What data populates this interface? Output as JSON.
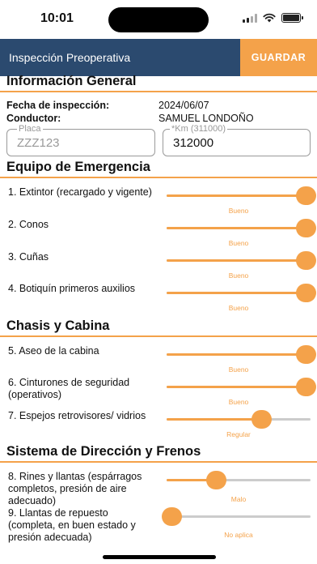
{
  "status": {
    "time": "10:01"
  },
  "header": {
    "title": "Inspección Preoperativa",
    "save_label": "GUARDAR"
  },
  "general": {
    "title": "Información General",
    "date_label": "Fecha de inspección:",
    "date_value": "2024/06/07",
    "driver_label": "Conductor:",
    "driver_value": "SAMUEL LONDOÑO",
    "plate_label": "Placa",
    "plate_value": "ZZZ123",
    "km_label": "*Km (311000)",
    "km_value": "312000"
  },
  "sections": {
    "emergency": {
      "title": "Equipo de Emergencia",
      "items": [
        {
          "label": "1. Extintor (recargado y vigente)",
          "value": "Bueno",
          "level": 1.0
        },
        {
          "label": "2. Conos",
          "value": "Bueno",
          "level": 1.0
        },
        {
          "label": "3. Cuñas",
          "value": "Bueno",
          "level": 1.0
        },
        {
          "label": "4. Botiquín primeros auxilios",
          "value": "Bueno",
          "level": 1.0
        }
      ]
    },
    "chassis": {
      "title": "Chasis y Cabina",
      "items": [
        {
          "label": "5. Aseo de la cabina",
          "value": "Bueno",
          "level": 1.0
        },
        {
          "label": "6. Cinturones de seguridad (operativos)",
          "value": "Bueno",
          "level": 1.0
        },
        {
          "label": "7. Espejos retrovisores/ vidrios",
          "value": "Regular",
          "level": 0.67
        }
      ]
    },
    "brakes": {
      "title": "Sistema de Dirección y Frenos",
      "items": [
        {
          "label": "8. Rines y llantas (espárragos completos, presión de aire adecuado)",
          "value": "Malo",
          "level": 0.33
        },
        {
          "label": "9. Llantas de repuesto (completa, en buen estado y presión adecuada)",
          "value": "No aplica",
          "level": 0.0
        }
      ]
    }
  },
  "colors": {
    "header": "#2b4a6f",
    "accent": "#f4a24a"
  }
}
